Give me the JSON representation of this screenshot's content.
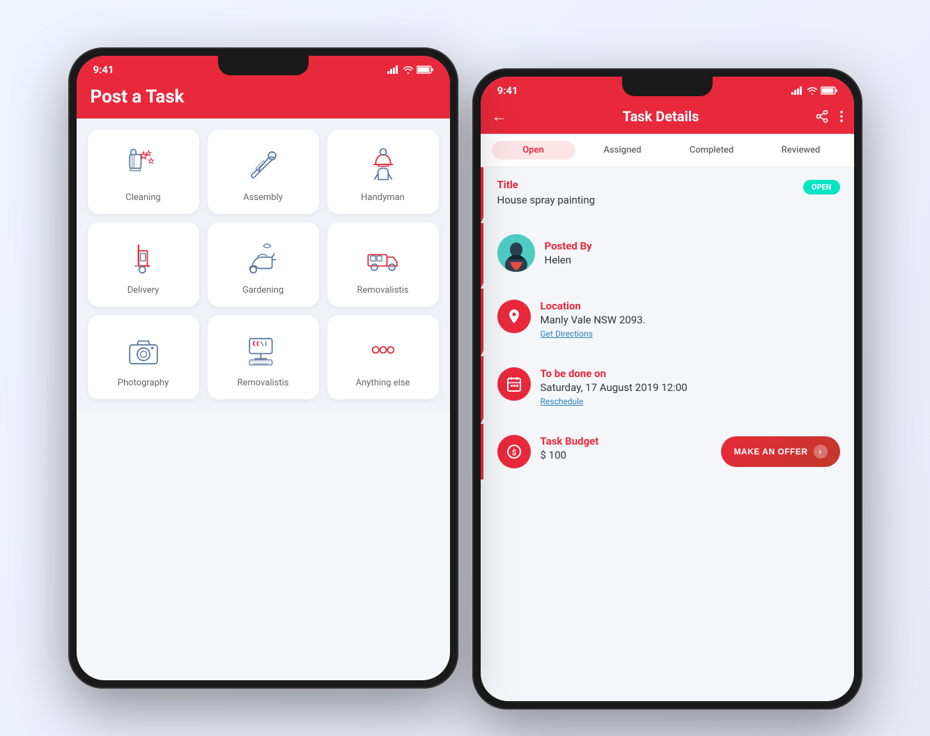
{
  "phone1": {
    "status": {
      "time": "9:41"
    },
    "header": {
      "title": "Post a Task"
    },
    "categories": [
      {
        "id": "cleaning",
        "label": "Cleaning",
        "icon": "cleaning"
      },
      {
        "id": "assembly",
        "label": "Assembly",
        "icon": "assembly"
      },
      {
        "id": "handyman",
        "label": "Handyman",
        "icon": "handyman"
      },
      {
        "id": "delivery",
        "label": "Delivery",
        "icon": "delivery"
      },
      {
        "id": "gardening",
        "label": "Gardening",
        "icon": "gardening"
      },
      {
        "id": "removalistis",
        "label": "Removalistis",
        "icon": "removalistis"
      },
      {
        "id": "photography",
        "label": "Photography",
        "icon": "photography"
      },
      {
        "id": "removalistis2",
        "label": "Removalistis",
        "icon": "removalistis2"
      },
      {
        "id": "anything",
        "label": "Anything else",
        "icon": "anything"
      }
    ]
  },
  "phone2": {
    "status": {
      "time": "9:41"
    },
    "header": {
      "title": "Task Details"
    },
    "tabs": [
      {
        "id": "open",
        "label": "Open",
        "active": true
      },
      {
        "id": "assigned",
        "label": "Assigned",
        "active": false
      },
      {
        "id": "completed",
        "label": "Completed",
        "active": false
      },
      {
        "id": "reviewed",
        "label": "Reviewed",
        "active": false
      }
    ],
    "task": {
      "title_label": "Title",
      "title_value": "House spray painting",
      "open_badge": "OPEN",
      "posted_by_label": "Posted By",
      "poster_name": "Helen",
      "location_label": "Location",
      "location_value": "Manly Vale NSW 2093.",
      "get_directions": "Get Directions",
      "schedule_label": "To be done on",
      "schedule_value": "Saturday, 17 August 2019 12:00",
      "reschedule": "Reschedule",
      "budget_label": "Task Budget",
      "budget_value": "$ 100",
      "make_offer_btn": "MAKE AN OFFER"
    }
  }
}
